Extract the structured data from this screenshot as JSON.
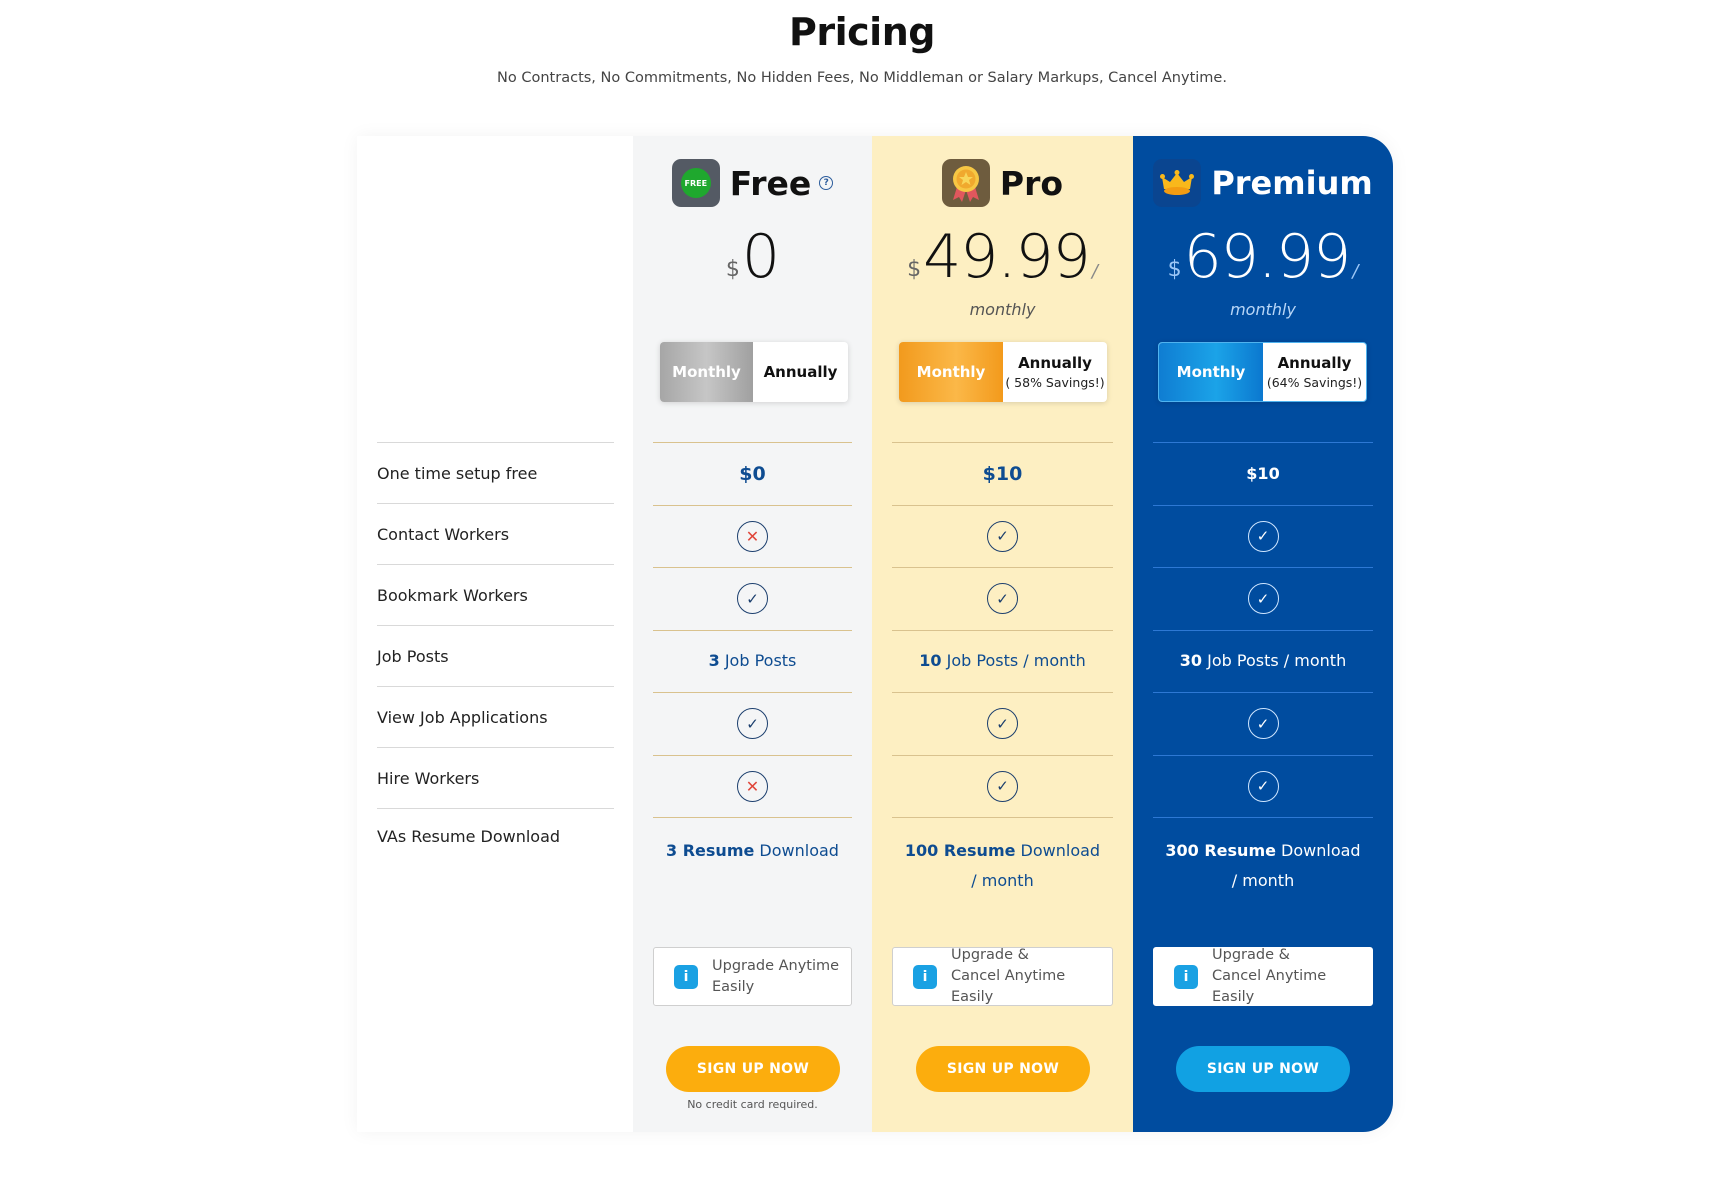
{
  "header": {
    "title": "Pricing",
    "subtitle": "No Contracts, No Commitments, No Hidden Fees, No Middleman or Salary Markups, Cancel Anytime."
  },
  "features": [
    "One time setup free",
    "Contact Workers",
    "Bookmark Workers",
    "Job Posts",
    "View Job Applications",
    "Hire Workers",
    "VAs Resume Download"
  ],
  "plans": {
    "free": {
      "name": "Free",
      "icon": "free-badge-icon",
      "icon_text": "FREE",
      "has_help": true,
      "currency": "$",
      "price": "0",
      "toggle": {
        "monthly": "Monthly",
        "annually": "Annually",
        "savings": ""
      },
      "setup_fee": "$0",
      "contact_workers": false,
      "bookmark_workers": true,
      "job_posts": {
        "count": "3",
        "text": " Job Posts"
      },
      "view_applications": true,
      "hire_workers": false,
      "resume": {
        "count": "3 Resume",
        "text": " Download"
      },
      "info": "Upgrade Anytime Easily",
      "cta": "SIGN UP NOW",
      "note": "No credit card required."
    },
    "pro": {
      "name": "Pro",
      "icon": "award-medal-icon",
      "currency": "$",
      "price": "49.99",
      "slash": "/",
      "period": "monthly",
      "toggle": {
        "monthly": "Monthly",
        "annually": "Annually",
        "savings": "( 58% Savings!)"
      },
      "setup_fee": "$10",
      "contact_workers": true,
      "bookmark_workers": true,
      "job_posts": {
        "count": "10",
        "text": " Job Posts / month"
      },
      "view_applications": true,
      "hire_workers": true,
      "resume": {
        "count": "100 Resume",
        "text": " Download / month"
      },
      "info": "Upgrade & Cancel Anytime Easily",
      "cta": "SIGN UP NOW"
    },
    "premium": {
      "name": "Premium",
      "icon": "crown-icon",
      "currency": "$",
      "price": "69.99",
      "slash": "/",
      "period": "monthly",
      "toggle": {
        "monthly": "Monthly",
        "annually": "Annually",
        "savings": "(64% Savings!)"
      },
      "setup_fee": "$10",
      "contact_workers": true,
      "bookmark_workers": true,
      "job_posts": {
        "count": "30",
        "text": " Job Posts / month"
      },
      "view_applications": true,
      "hire_workers": true,
      "resume": {
        "count": "300 Resume",
        "text": " Download / month"
      },
      "info": "Upgrade & Cancel Anytime Easily",
      "cta": "SIGN UP NOW"
    }
  },
  "icons": {
    "check": "✓",
    "cross": "✕",
    "info": "i",
    "help": "?"
  },
  "colors": {
    "free_bg": "#f4f5f6",
    "pro_bg": "#fdefc2",
    "premium_bg": "#004c9f",
    "cta_orange": "#fcad0d",
    "cta_blue": "#11a1e3",
    "value_blue": "#0e4c91",
    "cross_red": "#e0463a"
  }
}
